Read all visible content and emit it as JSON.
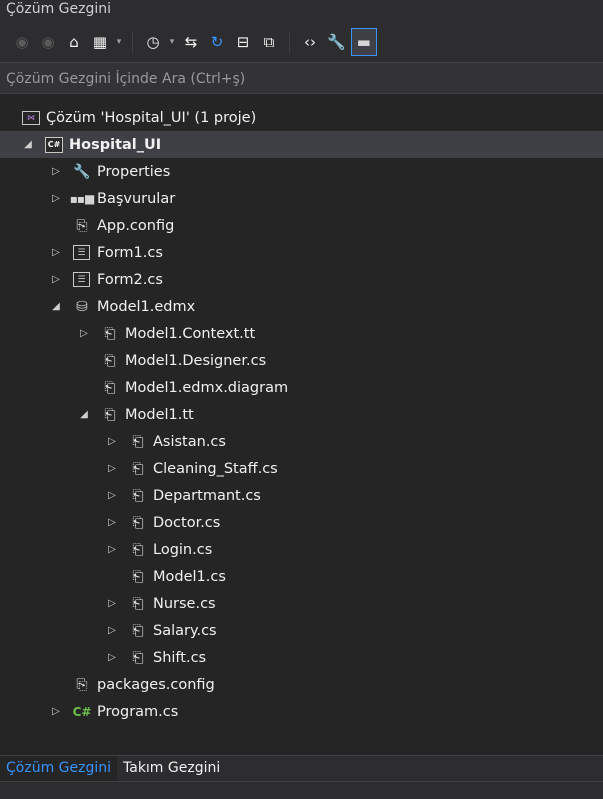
{
  "window": {
    "title": "Çözüm Gezgini"
  },
  "toolbar": {
    "buttons": [
      {
        "name": "back-button",
        "icon": "back-circle-icon",
        "glyph": "◉",
        "style": "dim"
      },
      {
        "name": "forward-button",
        "icon": "forward-circle-icon",
        "glyph": "◉",
        "style": "dim"
      },
      {
        "name": "home-button",
        "icon": "home-icon",
        "glyph": "⌂",
        "style": "white"
      },
      {
        "name": "switch-views-button",
        "icon": "switch-views-icon",
        "glyph": "▦",
        "style": "white"
      },
      {
        "name": "switch-views-dropdown",
        "icon": "chevron-down-icon",
        "glyph": "▾",
        "style": "drop"
      },
      {
        "name": "pending-changes-filter-button",
        "icon": "clock-filter-icon",
        "glyph": "◷",
        "style": "white"
      },
      {
        "name": "pending-changes-dropdown",
        "icon": "chevron-down-icon",
        "glyph": "▾",
        "style": "drop"
      },
      {
        "name": "sync-with-active-document-button",
        "icon": "sync-arrows-icon",
        "glyph": "⇆",
        "style": "white"
      },
      {
        "name": "refresh-button",
        "icon": "refresh-icon",
        "glyph": "↻",
        "style": "blue"
      },
      {
        "name": "collapse-all-button",
        "icon": "collapse-all-icon",
        "glyph": "⊟",
        "style": "white"
      },
      {
        "name": "show-all-files-button",
        "icon": "show-all-files-icon",
        "glyph": "⧉",
        "style": "white"
      },
      {
        "name": "view-code-button",
        "icon": "code-brackets-icon",
        "glyph": "‹›",
        "style": "white"
      },
      {
        "name": "properties-button",
        "icon": "wrench-icon",
        "glyph": "🔧",
        "style": "white"
      },
      {
        "name": "preview-selected-items-button",
        "icon": "preview-icon",
        "glyph": "▬",
        "style": "active"
      }
    ]
  },
  "search": {
    "placeholder": "Çözüm Gezgini İçinde Ara (Ctrl+ş)"
  },
  "tree": {
    "items": [
      {
        "label": "Çözüm 'Hospital_UI' (1 proje)",
        "level": 0,
        "expander": "",
        "icon": "solution-icon",
        "glyph": "⋈",
        "bold": false,
        "selected": false
      },
      {
        "label": "Hospital_UI",
        "level": 0,
        "expander": "◢",
        "icon": "csharp-project-icon",
        "glyph": "C#",
        "bold": true,
        "selected": true
      },
      {
        "label": "Properties",
        "level": 1,
        "expander": "▷",
        "icon": "wrench-icon",
        "glyph": "🔧",
        "bold": false,
        "selected": false
      },
      {
        "label": "Başvurular",
        "level": 1,
        "expander": "▷",
        "icon": "references-icon",
        "glyph": "▪▪■",
        "bold": false,
        "selected": false
      },
      {
        "label": "App.config",
        "level": 1,
        "expander": "",
        "icon": "config-file-icon",
        "glyph": "⎘",
        "bold": false,
        "selected": false
      },
      {
        "label": "Form1.cs",
        "level": 1,
        "expander": "▷",
        "icon": "form-icon",
        "glyph": "☰",
        "bold": false,
        "selected": false
      },
      {
        "label": "Form2.cs",
        "level": 1,
        "expander": "▷",
        "icon": "form-icon",
        "glyph": "☰",
        "bold": false,
        "selected": false
      },
      {
        "label": "Model1.edmx",
        "level": 1,
        "expander": "◢",
        "icon": "edmx-model-icon",
        "glyph": "⛁",
        "bold": false,
        "selected": false
      },
      {
        "label": "Model1.Context.tt",
        "level": 2,
        "expander": "▷",
        "icon": "tt-file-icon",
        "glyph": "⎗",
        "bold": false,
        "selected": false
      },
      {
        "label": "Model1.Designer.cs",
        "level": 2,
        "expander": "",
        "icon": "tt-file-icon",
        "glyph": "⎗",
        "bold": false,
        "selected": false
      },
      {
        "label": "Model1.edmx.diagram",
        "level": 2,
        "expander": "",
        "icon": "tt-file-icon",
        "glyph": "⎗",
        "bold": false,
        "selected": false
      },
      {
        "label": "Model1.tt",
        "level": 2,
        "expander": "◢",
        "icon": "tt-file-icon",
        "glyph": "⎗",
        "bold": false,
        "selected": false
      },
      {
        "label": "Asistan.cs",
        "level": 3,
        "expander": "▷",
        "icon": "cs-file-icon",
        "glyph": "⎗",
        "bold": false,
        "selected": false
      },
      {
        "label": "Cleaning_Staff.cs",
        "level": 3,
        "expander": "▷",
        "icon": "cs-file-icon",
        "glyph": "⎗",
        "bold": false,
        "selected": false
      },
      {
        "label": "Departmant.cs",
        "level": 3,
        "expander": "▷",
        "icon": "cs-file-icon",
        "glyph": "⎗",
        "bold": false,
        "selected": false
      },
      {
        "label": "Doctor.cs",
        "level": 3,
        "expander": "▷",
        "icon": "cs-file-icon",
        "glyph": "⎗",
        "bold": false,
        "selected": false
      },
      {
        "label": "Login.cs",
        "level": 3,
        "expander": "▷",
        "icon": "cs-file-icon",
        "glyph": "⎗",
        "bold": false,
        "selected": false
      },
      {
        "label": "Model1.cs",
        "level": 3,
        "expander": "",
        "icon": "cs-file-icon",
        "glyph": "⎗",
        "bold": false,
        "selected": false
      },
      {
        "label": "Nurse.cs",
        "level": 3,
        "expander": "▷",
        "icon": "cs-file-icon",
        "glyph": "⎗",
        "bold": false,
        "selected": false
      },
      {
        "label": "Salary.cs",
        "level": 3,
        "expander": "▷",
        "icon": "cs-file-icon",
        "glyph": "⎗",
        "bold": false,
        "selected": false
      },
      {
        "label": "Shift.cs",
        "level": 3,
        "expander": "▷",
        "icon": "cs-file-icon",
        "glyph": "⎗",
        "bold": false,
        "selected": false
      },
      {
        "label": "packages.config",
        "level": 1,
        "expander": "",
        "icon": "config-file-icon",
        "glyph": "⎘",
        "bold": false,
        "selected": false
      },
      {
        "label": "Program.cs",
        "level": 1,
        "expander": "▷",
        "icon": "csharp-file-icon",
        "glyph": "C#",
        "bold": false,
        "selected": false
      }
    ]
  },
  "tabs": [
    {
      "label": "Çözüm Gezgini",
      "active": true
    },
    {
      "label": "Takım Gezgini",
      "active": false
    }
  ],
  "colors": {
    "background": "#252526",
    "accent": "#3794ff",
    "selection": "#3f3f46"
  }
}
